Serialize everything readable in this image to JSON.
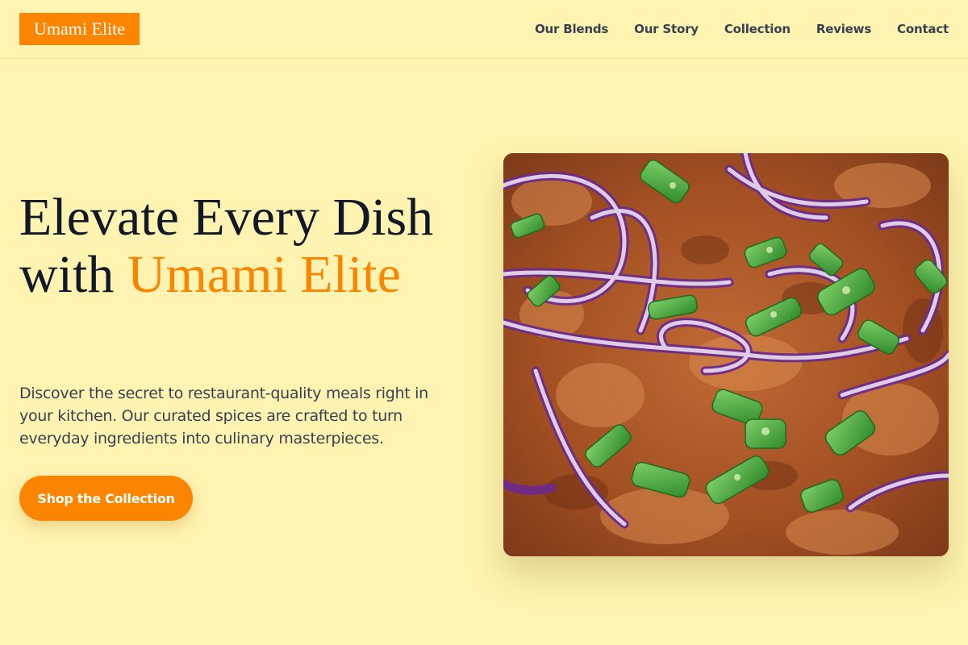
{
  "brand": {
    "name": "Umami Elite",
    "color": "#fb8500"
  },
  "nav": {
    "items": [
      {
        "label": "Our Blends"
      },
      {
        "label": "Our Story"
      },
      {
        "label": "Collection"
      },
      {
        "label": "Reviews"
      },
      {
        "label": "Contact"
      }
    ]
  },
  "hero": {
    "headline_part1": "Elevate Every Dish with ",
    "headline_accent": "Umami Elite",
    "description": "Discover the secret to restaurant-quality meals right in your kitchen. Our curated spices are crafted to turn everyday ingredients into culinary masterpieces.",
    "cta_label": "Shop the Collection",
    "image_icon": "food-photo-onions-scallions"
  },
  "colors": {
    "background": "#fef3b0",
    "accent": "#fb8500",
    "text_dark": "#111827",
    "text_body": "#374151"
  }
}
